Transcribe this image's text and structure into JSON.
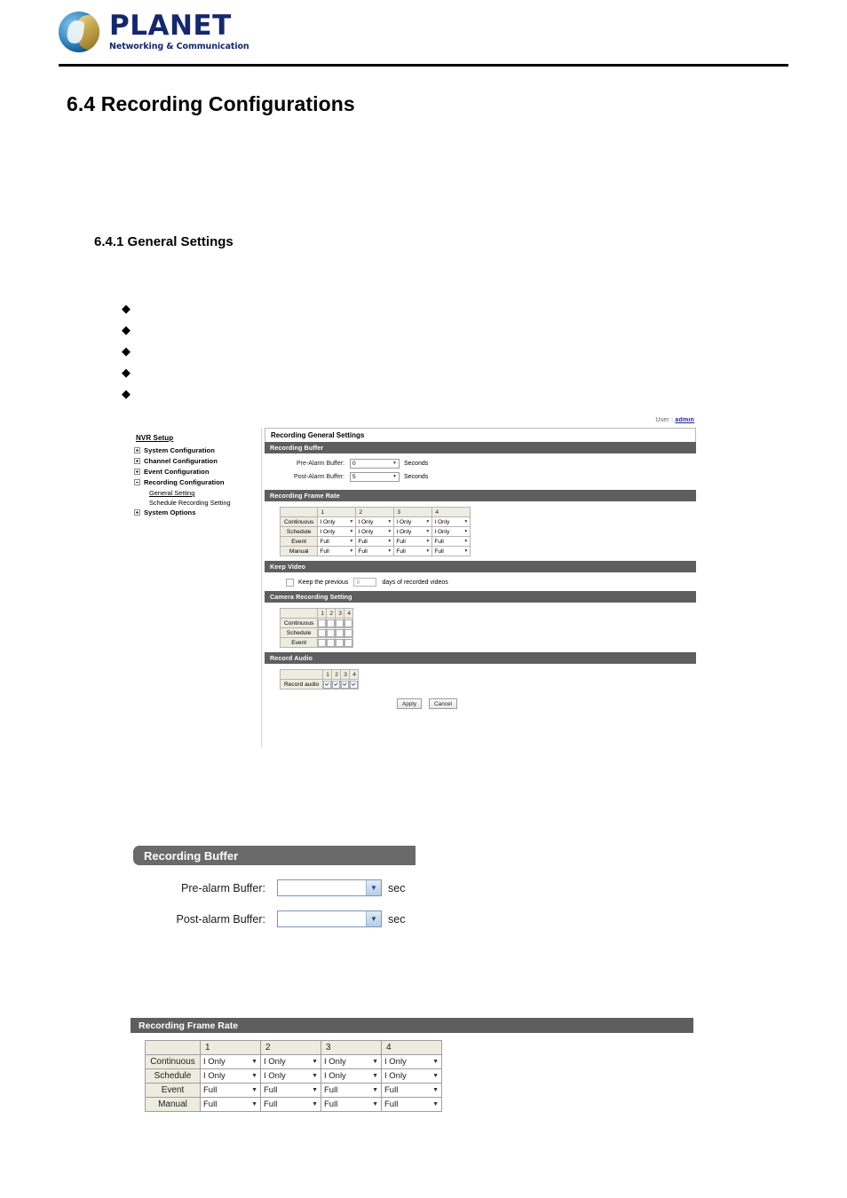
{
  "brand": {
    "name": "PLANET",
    "tagline": "Networking & Communication"
  },
  "document": {
    "section_heading": "6.4 Recording Configurations",
    "subsection_heading": "6.4.1 General Settings",
    "bullets": [
      "",
      "",
      "",
      "",
      ""
    ]
  },
  "nvr": {
    "user_label": "User :",
    "user_name": "admin",
    "sidebar": {
      "title": "NVR Setup",
      "items": [
        {
          "label": "System Configuration",
          "state": "collapsed"
        },
        {
          "label": "Channel Configuration",
          "state": "collapsed"
        },
        {
          "label": "Event Configuration",
          "state": "collapsed"
        },
        {
          "label": "Recording Configuration",
          "state": "expanded"
        },
        {
          "label": "System Options",
          "state": "collapsed"
        }
      ],
      "children": [
        {
          "label": "General Setting",
          "active": true
        },
        {
          "label": "Schedule Recording Setting",
          "active": false
        }
      ]
    },
    "panel_title": "Recording General Settings",
    "recording_buffer": {
      "bar": "Recording Buffer",
      "pre_label": "Pre-Alarm Buffer:",
      "pre_value": "0",
      "pre_unit": "Seconds",
      "post_label": "Post-Alarm Buffer:",
      "post_value": "5",
      "post_unit": "Seconds"
    },
    "frame_rate": {
      "bar": "Recording Frame Rate",
      "columns": [
        "1",
        "2",
        "3",
        "4"
      ],
      "rows": [
        {
          "label": "Continuous",
          "values": [
            "I Only",
            "I Only",
            "I Only",
            "I Only"
          ]
        },
        {
          "label": "Schedule",
          "values": [
            "I Only",
            "I Only",
            "I Only",
            "I Only"
          ]
        },
        {
          "label": "Event",
          "values": [
            "Full",
            "Full",
            "Full",
            "Full"
          ]
        },
        {
          "label": "Manual",
          "values": [
            "Full",
            "Full",
            "Full",
            "Full"
          ]
        }
      ]
    },
    "keep_video": {
      "bar": "Keep Video",
      "checked": false,
      "prefix": "Keep the previous",
      "days_value": "0",
      "suffix": "days of recorded videos"
    },
    "camera_recording": {
      "bar": "Camera Recording Setting",
      "columns": [
        "1",
        "2",
        "3",
        "4"
      ],
      "rows": [
        {
          "label": "Continuous",
          "checked": [
            false,
            false,
            false,
            false
          ]
        },
        {
          "label": "Schedule",
          "checked": [
            false,
            false,
            false,
            false
          ]
        },
        {
          "label": "Event",
          "checked": [
            false,
            false,
            false,
            false
          ]
        }
      ]
    },
    "record_audio": {
      "bar": "Record Audio",
      "columns": [
        "1",
        "2",
        "3",
        "4"
      ],
      "rows": [
        {
          "label": "Record audio",
          "checked": [
            true,
            true,
            true,
            true
          ]
        }
      ]
    },
    "buttons": {
      "apply": "Apply",
      "cancel": "Cancel"
    }
  },
  "figure_recording_buffer": {
    "bar": "Recording Buffer",
    "pre_label": "Pre-alarm Buffer:",
    "pre_value": "",
    "pre_unit": "sec",
    "post_label": "Post-alarm Buffer:",
    "post_value": "",
    "post_unit": "sec"
  },
  "figure_frame_rate": {
    "bar": "Recording Frame Rate",
    "columns": [
      "1",
      "2",
      "3",
      "4"
    ],
    "rows": [
      {
        "label": "Continuous",
        "values": [
          "I Only",
          "I Only",
          "I Only",
          "I Only"
        ]
      },
      {
        "label": "Schedule",
        "values": [
          "I Only",
          "I Only",
          "I Only",
          "I Only"
        ]
      },
      {
        "label": "Event",
        "values": [
          "Full",
          "Full",
          "Full",
          "Full"
        ]
      },
      {
        "label": "Manual",
        "values": [
          "Full",
          "Full",
          "Full",
          "Full"
        ]
      }
    ]
  },
  "colors": {
    "brand_navy": "#15286b",
    "bar_gray": "#5e5e5e",
    "bar_gray_light": "#6a6a6a",
    "table_header_cream": "#eeebdf",
    "link_blue": "#2424a8"
  }
}
